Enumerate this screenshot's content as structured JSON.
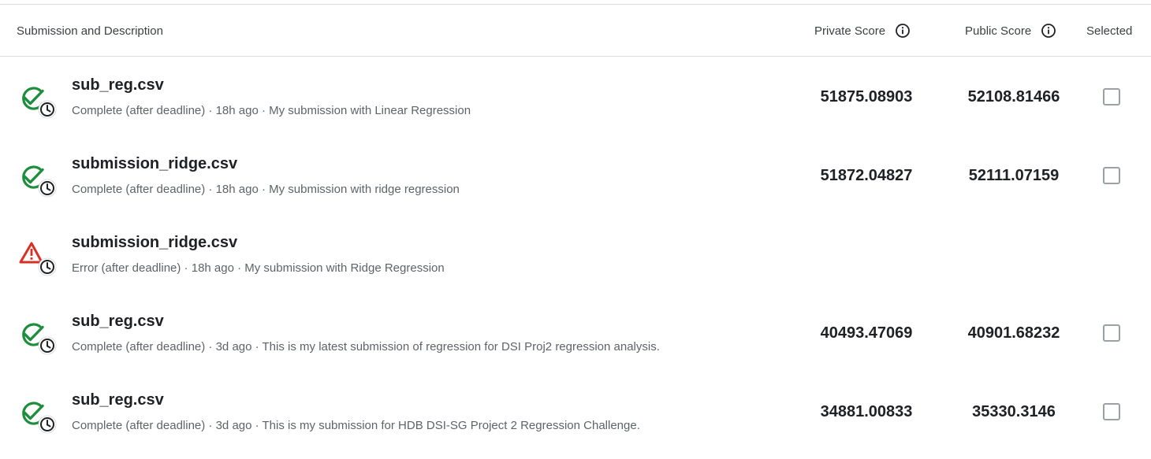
{
  "header": {
    "submission_label": "Submission and Description",
    "private_label": "Private Score",
    "public_label": "Public Score",
    "selected_label": "Selected"
  },
  "colors": {
    "success": "#1e8e3e",
    "error": "#d93025",
    "clock": "#202124"
  },
  "rows": [
    {
      "status_icon": "check-clock-icon",
      "filename": "sub_reg.csv",
      "description": "Complete (after deadline) · 18h ago · My submission with Linear Regression",
      "private_score": "51875.08903",
      "public_score": "52108.81466",
      "has_checkbox": true
    },
    {
      "status_icon": "check-clock-icon",
      "filename": "submission_ridge.csv",
      "description": "Complete (after deadline) · 18h ago · My submission with ridge regression",
      "private_score": "51872.04827",
      "public_score": "52111.07159",
      "has_checkbox": true
    },
    {
      "status_icon": "warning-clock-icon",
      "filename": "submission_ridge.csv",
      "description": "Error (after deadline) · 18h ago · My submission with Ridge Regression",
      "private_score": "",
      "public_score": "",
      "has_checkbox": false
    },
    {
      "status_icon": "check-clock-icon",
      "filename": "sub_reg.csv",
      "description": "Complete (after deadline) · 3d ago · This is my latest submission of regression for DSI Proj2 regression analysis.",
      "private_score": "40493.47069",
      "public_score": "40901.68232",
      "has_checkbox": true
    },
    {
      "status_icon": "check-clock-icon",
      "filename": "sub_reg.csv",
      "description": "Complete (after deadline) · 3d ago · This is my submission for HDB DSI-SG Project 2 Regression Challenge.",
      "private_score": "34881.00833",
      "public_score": "35330.3146",
      "has_checkbox": true
    }
  ]
}
